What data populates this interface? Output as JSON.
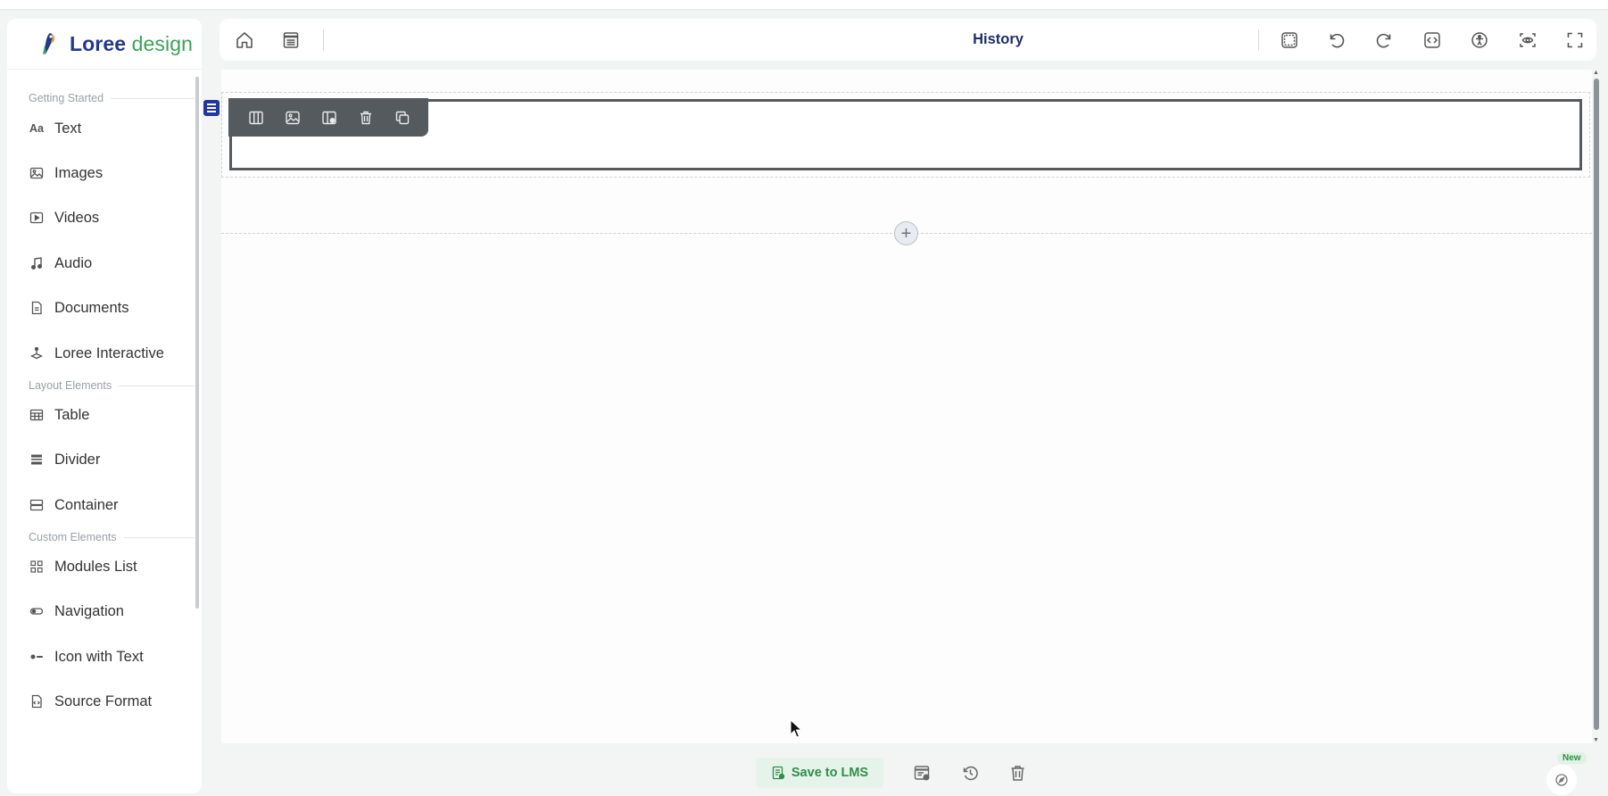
{
  "app": {
    "brand_part1": "Loree",
    "brand_part2": "design"
  },
  "sidebar": {
    "sections": [
      {
        "title": "Getting Started"
      },
      {
        "title": "Layout Elements"
      },
      {
        "title": "Custom Elements"
      }
    ],
    "items": [
      {
        "label": "Text",
        "icon": "text-aa-icon"
      },
      {
        "label": "Images",
        "icon": "image-icon"
      },
      {
        "label": "Videos",
        "icon": "video-icon"
      },
      {
        "label": "Audio",
        "icon": "music-note-icon"
      },
      {
        "label": "Documents",
        "icon": "document-icon"
      },
      {
        "label": "Loree Interactive",
        "icon": "interactive-icon"
      },
      {
        "label": "Table",
        "icon": "table-icon"
      },
      {
        "label": "Divider",
        "icon": "divider-icon"
      },
      {
        "label": "Container",
        "icon": "container-icon"
      },
      {
        "label": "Modules List",
        "icon": "grid-icon"
      },
      {
        "label": "Navigation",
        "icon": "navigation-icon"
      },
      {
        "label": "Icon with Text",
        "icon": "icon-text-icon"
      },
      {
        "label": "Source Format",
        "icon": "source-format-icon"
      }
    ],
    "text_icon_glyph": "Aa"
  },
  "topbar": {
    "title": "History",
    "left_icons": [
      "home-icon",
      "template-icon"
    ],
    "right_icons": [
      "container-outline-icon",
      "undo-icon",
      "redo-icon",
      "code-icon",
      "accessibility-icon",
      "preview-icon",
      "fullscreen-icon"
    ]
  },
  "canvas": {
    "row_tools": [
      "columns-icon",
      "background-image-icon",
      "column-settings-icon",
      "delete-icon",
      "duplicate-icon"
    ],
    "add_symbol": "+"
  },
  "bottombar": {
    "save_label": "Save to LMS",
    "icons": [
      "save-template-icon",
      "history-icon",
      "trash-icon"
    ],
    "new_badge": "New"
  },
  "colors": {
    "brand_blue": "#233a8c",
    "brand_green": "#3aa357",
    "save_green": "#2e8f4a",
    "row_border": "#555a5e"
  }
}
